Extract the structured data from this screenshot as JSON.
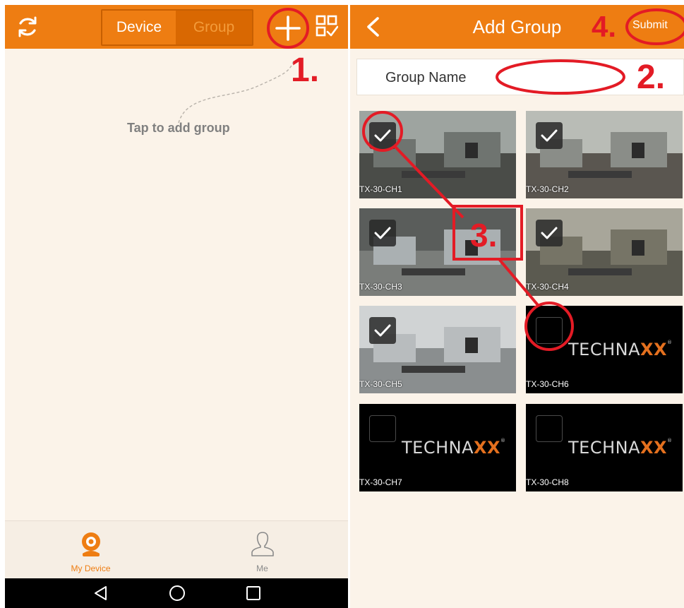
{
  "left": {
    "header": {
      "seg_device": "Device",
      "seg_group": "Group"
    },
    "hint": "Tap to add group",
    "tabs": [
      {
        "label": "My Device"
      },
      {
        "label": "Me"
      }
    ],
    "icons": [
      "refresh-icon",
      "plus-icon",
      "qr-scan-icon",
      "camera-icon",
      "person-icon",
      "back-triangle-icon",
      "home-circle-icon",
      "recents-square-icon"
    ]
  },
  "right": {
    "header": {
      "title": "Add Group",
      "submit": "Submit"
    },
    "form": {
      "label": "Group Name",
      "value": ""
    },
    "cameras": [
      {
        "label": "TX-30-CH1",
        "checked": true,
        "online": true
      },
      {
        "label": "TX-30-CH2",
        "checked": true,
        "online": true
      },
      {
        "label": "TX-30-CH3",
        "checked": true,
        "online": true
      },
      {
        "label": "TX-30-CH4",
        "checked": true,
        "online": true
      },
      {
        "label": "TX-30-CH5",
        "checked": true,
        "online": true
      },
      {
        "label": "TX-30-CH6",
        "checked": false,
        "online": false
      },
      {
        "label": "TX-30-CH7",
        "checked": false,
        "online": false
      },
      {
        "label": "TX-30-CH8",
        "checked": false,
        "online": false
      }
    ],
    "logo": {
      "text": "TECHNA",
      "accent": "XX",
      "mark": "®"
    }
  },
  "annotations": {
    "step1": "1.",
    "step2": "2.",
    "step3": "3.",
    "step4": "4."
  },
  "colors": {
    "accent": "#ee7d12",
    "background": "#fbf3e9",
    "annotation": "#e31b25"
  }
}
